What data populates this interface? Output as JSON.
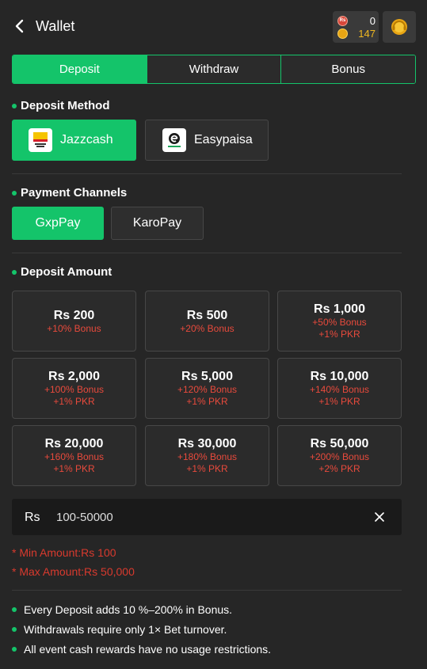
{
  "header": {
    "title": "Wallet",
    "cash_icon_text": "Rs",
    "cash_balance": "0",
    "coin_balance": "147"
  },
  "tabs": [
    {
      "label": "Deposit",
      "active": true
    },
    {
      "label": "Withdraw",
      "active": false
    },
    {
      "label": "Bonus",
      "active": false
    }
  ],
  "deposit_method": {
    "title": "Deposit Method",
    "options": [
      {
        "label": "Jazzcash",
        "selected": true
      },
      {
        "label": "Easypaisa",
        "selected": false
      }
    ]
  },
  "payment_channels": {
    "title": "Payment Channels",
    "options": [
      {
        "label": "GxpPay",
        "selected": true
      },
      {
        "label": "KaroPay",
        "selected": false
      }
    ]
  },
  "deposit_amount": {
    "title": "Deposit Amount",
    "options": [
      {
        "amount": "Rs 200",
        "bonus": "+10% Bonus",
        "pkr": ""
      },
      {
        "amount": "Rs 500",
        "bonus": "+20% Bonus",
        "pkr": ""
      },
      {
        "amount": "Rs 1,000",
        "bonus": "+50% Bonus",
        "pkr": "+1% PKR"
      },
      {
        "amount": "Rs 2,000",
        "bonus": "+100% Bonus",
        "pkr": "+1% PKR"
      },
      {
        "amount": "Rs 5,000",
        "bonus": "+120% Bonus",
        "pkr": "+1% PKR"
      },
      {
        "amount": "Rs 10,000",
        "bonus": "+140% Bonus",
        "pkr": "+1% PKR"
      },
      {
        "amount": "Rs 20,000",
        "bonus": "+160% Bonus",
        "pkr": "+1% PKR"
      },
      {
        "amount": "Rs 30,000",
        "bonus": "+180% Bonus",
        "pkr": "+1% PKR"
      },
      {
        "amount": "Rs 50,000",
        "bonus": "+200% Bonus",
        "pkr": "+2% PKR"
      }
    ]
  },
  "amount_input": {
    "prefix": "Rs",
    "placeholder": "100-50000"
  },
  "limits": {
    "min": "* Min Amount:Rs 100",
    "max": "* Max Amount:Rs 50,000"
  },
  "notes": [
    "Every Deposit adds 10 %–200% in Bonus.",
    "Withdrawals require only 1× Bet turnover.",
    "All event cash rewards have no usage restrictions."
  ],
  "colors": {
    "accent": "#14c46a",
    "background": "#262626",
    "bonus_text": "#e84a3c",
    "limit_text": "#d93a2e"
  }
}
